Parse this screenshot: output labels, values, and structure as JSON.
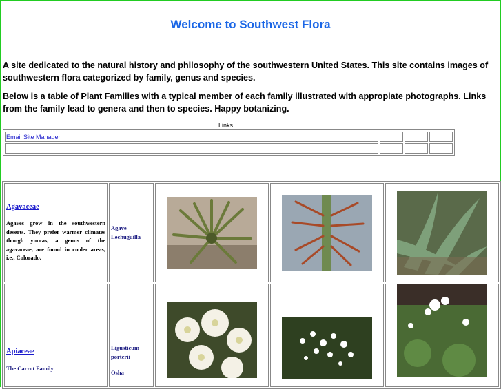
{
  "header": {
    "title": "Welcome to Southwest Flora",
    "intro": "A site dedicated to the natural history and philosophy of the southwestern United States. This site contains images of southwestern flora categorized by family, genus and species.",
    "intro2": "Below is a table of Plant Families with a typical member of each family illustrated with appropiate photographs. Links from the family lead to genera and then to species. Happy botanizing."
  },
  "links": {
    "label": "Links",
    "email": "Email Site Manager"
  },
  "families": [
    {
      "name": "Agavaceae",
      "desc": "Agaves grow in the southwestern deserts. They prefer warmer climates though yuccas, a genus of the agavaceae, are found in cooler areas, i.e., Colorado.",
      "genus": "Agave Lechuguilla"
    },
    {
      "name": "Apiaceae",
      "subtitle": "The Carrot Family",
      "genus": "Ligusticum porterii",
      "genus2": "Osha"
    }
  ]
}
